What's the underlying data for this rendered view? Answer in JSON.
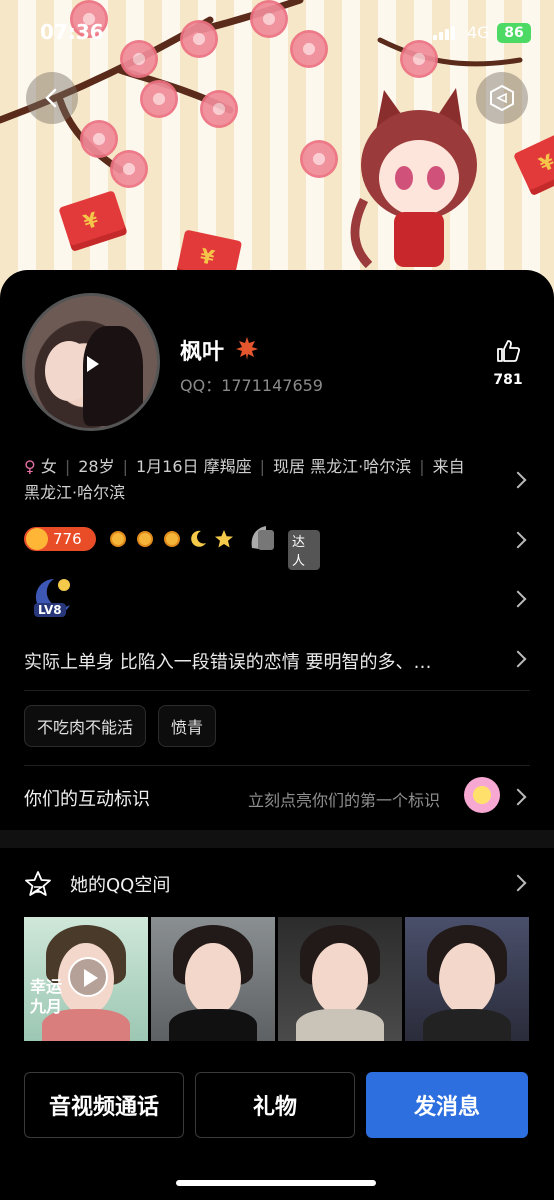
{
  "status_bar": {
    "time": "07:36",
    "network": "4G",
    "battery": "86"
  },
  "profile": {
    "name": "枫叶",
    "qq_label": "QQ：1771147659",
    "likes": "781",
    "gender": "女",
    "age": "28岁",
    "birthday": "1月16日 摩羯座",
    "residence": "现居 黑龙江·哈尔滨",
    "hometown_prefix": "来自",
    "hometown": "黑龙江·哈尔滨",
    "level_points": "776",
    "daren_label": "达人",
    "lv_badge": "LV8",
    "signature": "实际上单身 比陷入一段错误的恋情 要明智的多、…"
  },
  "tags": [
    "不吃肉不能活",
    "愤青"
  ],
  "interaction": {
    "label": "你们的互动标识",
    "hint": "立刻点亮你们的第一个标识"
  },
  "zone": {
    "title": "她的QQ空间",
    "photo1_text": "幸运",
    "photo1_text2": "九月"
  },
  "actions": {
    "call": "音视频通话",
    "gift": "礼物",
    "message": "发消息"
  },
  "colors": {
    "accent": "#2e6fe0",
    "level_badge": "#e84d28"
  }
}
